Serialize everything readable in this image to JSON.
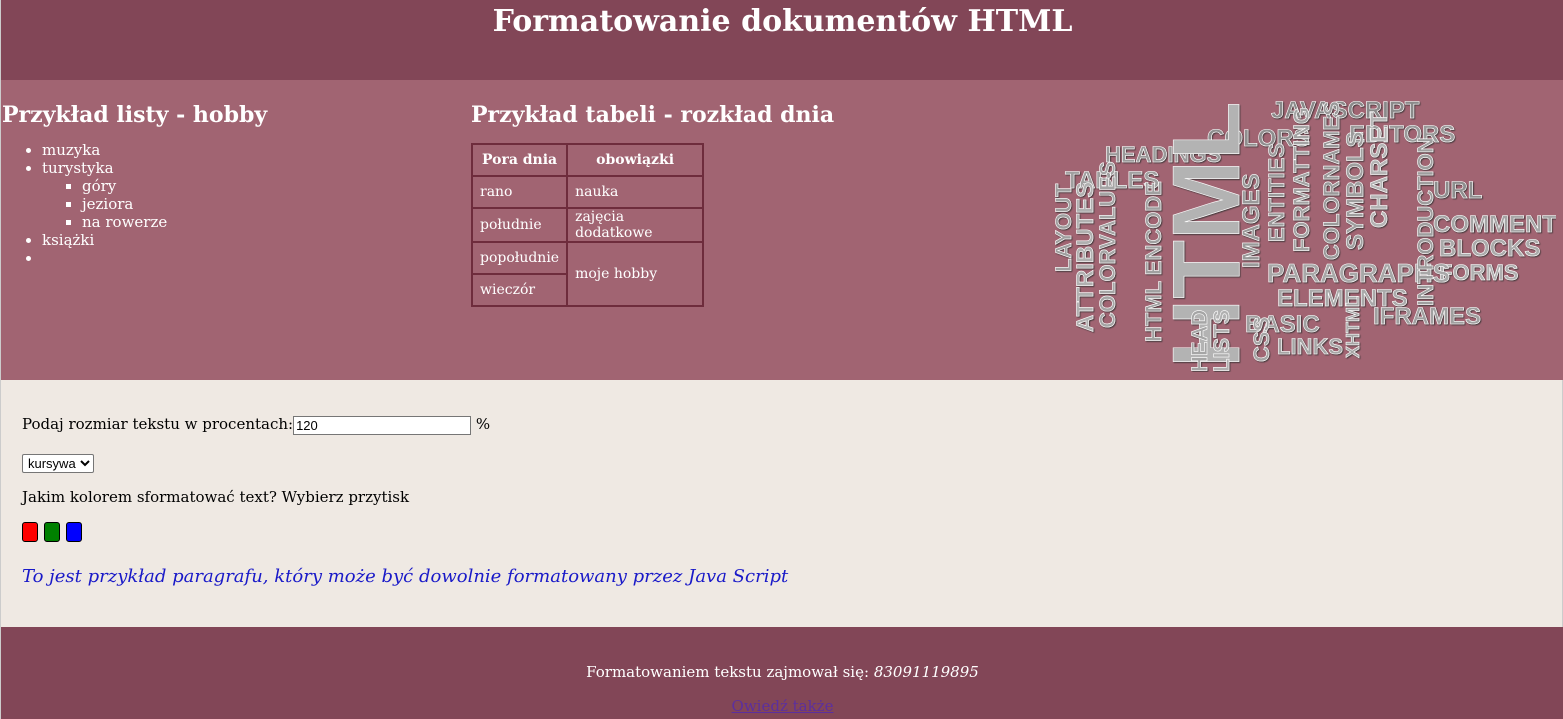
{
  "header": {
    "title": "Formatowanie dokumentów HTML"
  },
  "list_section": {
    "heading": "Przykład listy - hobby",
    "items": [
      {
        "label": "muzyka"
      },
      {
        "label": "turystyka",
        "subitems": [
          "góry",
          "jeziora",
          "na rowerze"
        ]
      },
      {
        "label": "książki"
      },
      {
        "label": ""
      }
    ]
  },
  "table_section": {
    "heading": "Przykład tabeli - rozkład dnia",
    "headers": [
      "Pora dnia",
      "obowiązki"
    ],
    "rows": [
      [
        "rano",
        "nauka"
      ],
      [
        "południe",
        "zajęcia dodatkowe"
      ],
      [
        "popołudnie",
        "moje hobby"
      ],
      [
        "wieczór",
        ""
      ]
    ]
  },
  "word_cloud": {
    "words": [
      "JAVASCRIPT",
      "EDITORS",
      "COLORS",
      "HEADINGS",
      "TABLES",
      "HTML",
      "URL",
      "COMMENTS",
      "BLOCKS",
      "FORMS",
      "IFRAMES",
      "PARAGRAPHS",
      "ELEMENTS",
      "BASIC",
      "LINKS",
      "IMAGES",
      "ENTITIES",
      "FORMATTING",
      "COLORNAMES",
      "SYMBOLS",
      "CHARSET",
      "INTRODUCTION",
      "LAYOUT",
      "ATTRIBUTES",
      "COLORVALUES",
      "HTML ENCODE",
      "HEAD",
      "LISTS",
      "CSS",
      "XHTML"
    ]
  },
  "form": {
    "size_label": "Podaj rozmiar tekstu w procentach:",
    "size_value": "120",
    "size_unit": "%",
    "style_selected": "kursywa",
    "color_prompt": "Jakim kolorem sformatować text? Wybierz przytisk",
    "color_buttons": [
      "#ff0000",
      "#008000",
      "#0000ff"
    ],
    "sample_paragraph": "To jest przykład paragrafu, który może być dowolnie formatowany przez Java Script"
  },
  "footer": {
    "author_label": "Formatowaniem tekstu zajmował się:",
    "author_id": "83091119895",
    "link_text": "Owiedź także"
  }
}
